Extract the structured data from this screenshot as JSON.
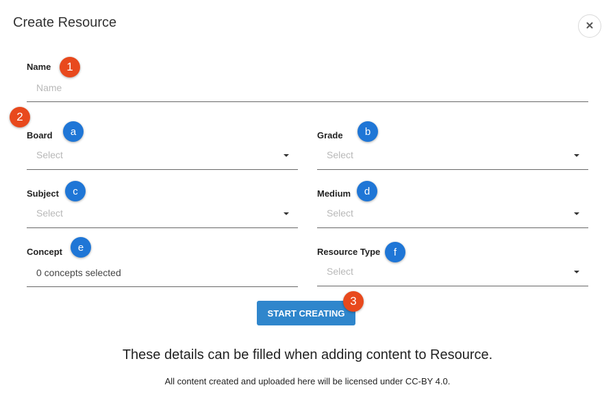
{
  "dialog": {
    "title": "Create Resource",
    "close_icon": "close-icon"
  },
  "fields": {
    "name": {
      "label": "Name",
      "placeholder": "Name"
    },
    "board": {
      "label": "Board",
      "placeholder": "Select"
    },
    "grade": {
      "label": "Grade",
      "placeholder": "Select"
    },
    "subject": {
      "label": "Subject",
      "placeholder": "Select"
    },
    "medium": {
      "label": "Medium",
      "placeholder": "Select"
    },
    "concept": {
      "label": "Concept",
      "value": "0 concepts selected"
    },
    "resource_type": {
      "label": "Resource Type",
      "placeholder": "Select"
    }
  },
  "annotations": {
    "step1": "1",
    "step2": "2",
    "step3": "3",
    "a": "a",
    "b": "b",
    "c": "c",
    "d": "d",
    "e": "e",
    "f": "f"
  },
  "actions": {
    "start_creating": "START CREATING"
  },
  "footer": {
    "info": "These details can be filled when adding content to Resource.",
    "license": "All content created and uploaded here will be licensed under CC-BY 4.0."
  },
  "colors": {
    "primary": "#2f86cc",
    "annotation_red": "#e8491d",
    "annotation_blue": "#1f76d6"
  }
}
